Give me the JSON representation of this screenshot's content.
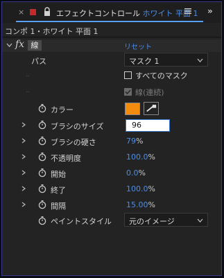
{
  "tab": {
    "close": "×",
    "title": "エフェクトコントロール",
    "layer": "ホワイト 平面 1",
    "more": "»"
  },
  "breadcrumb": "コンポ 1・ホワイト 平面 1",
  "effect": {
    "name": "線",
    "reset_label": "リセット"
  },
  "path": {
    "label": "パス",
    "value": "マスク 1"
  },
  "all_masks": {
    "label": "すべてのマスク",
    "checked": false
  },
  "stroke_sequential": {
    "label": "線(連続)",
    "checked": true,
    "enabled": false
  },
  "color": {
    "label": "カラー",
    "hex": "#f58b0e"
  },
  "brush_size": {
    "label": "ブラシのサイズ",
    "value": "96"
  },
  "brush_hardness": {
    "label": "ブラシの硬さ",
    "value": "79",
    "unit": "%"
  },
  "opacity": {
    "label": "不透明度",
    "value": "100.0",
    "unit": "%"
  },
  "start": {
    "label": "開始",
    "value": "0.0",
    "unit": "%"
  },
  "end": {
    "label": "終了",
    "value": "100.0",
    "unit": "%"
  },
  "spacing": {
    "label": "間隔",
    "value": "15.00",
    "unit": "%"
  },
  "paint_style": {
    "label": "ペイントスタイル",
    "value": "元のイメージ"
  },
  "colors": {
    "accent": "#4d8ee6",
    "label_color": "#c5282d"
  }
}
